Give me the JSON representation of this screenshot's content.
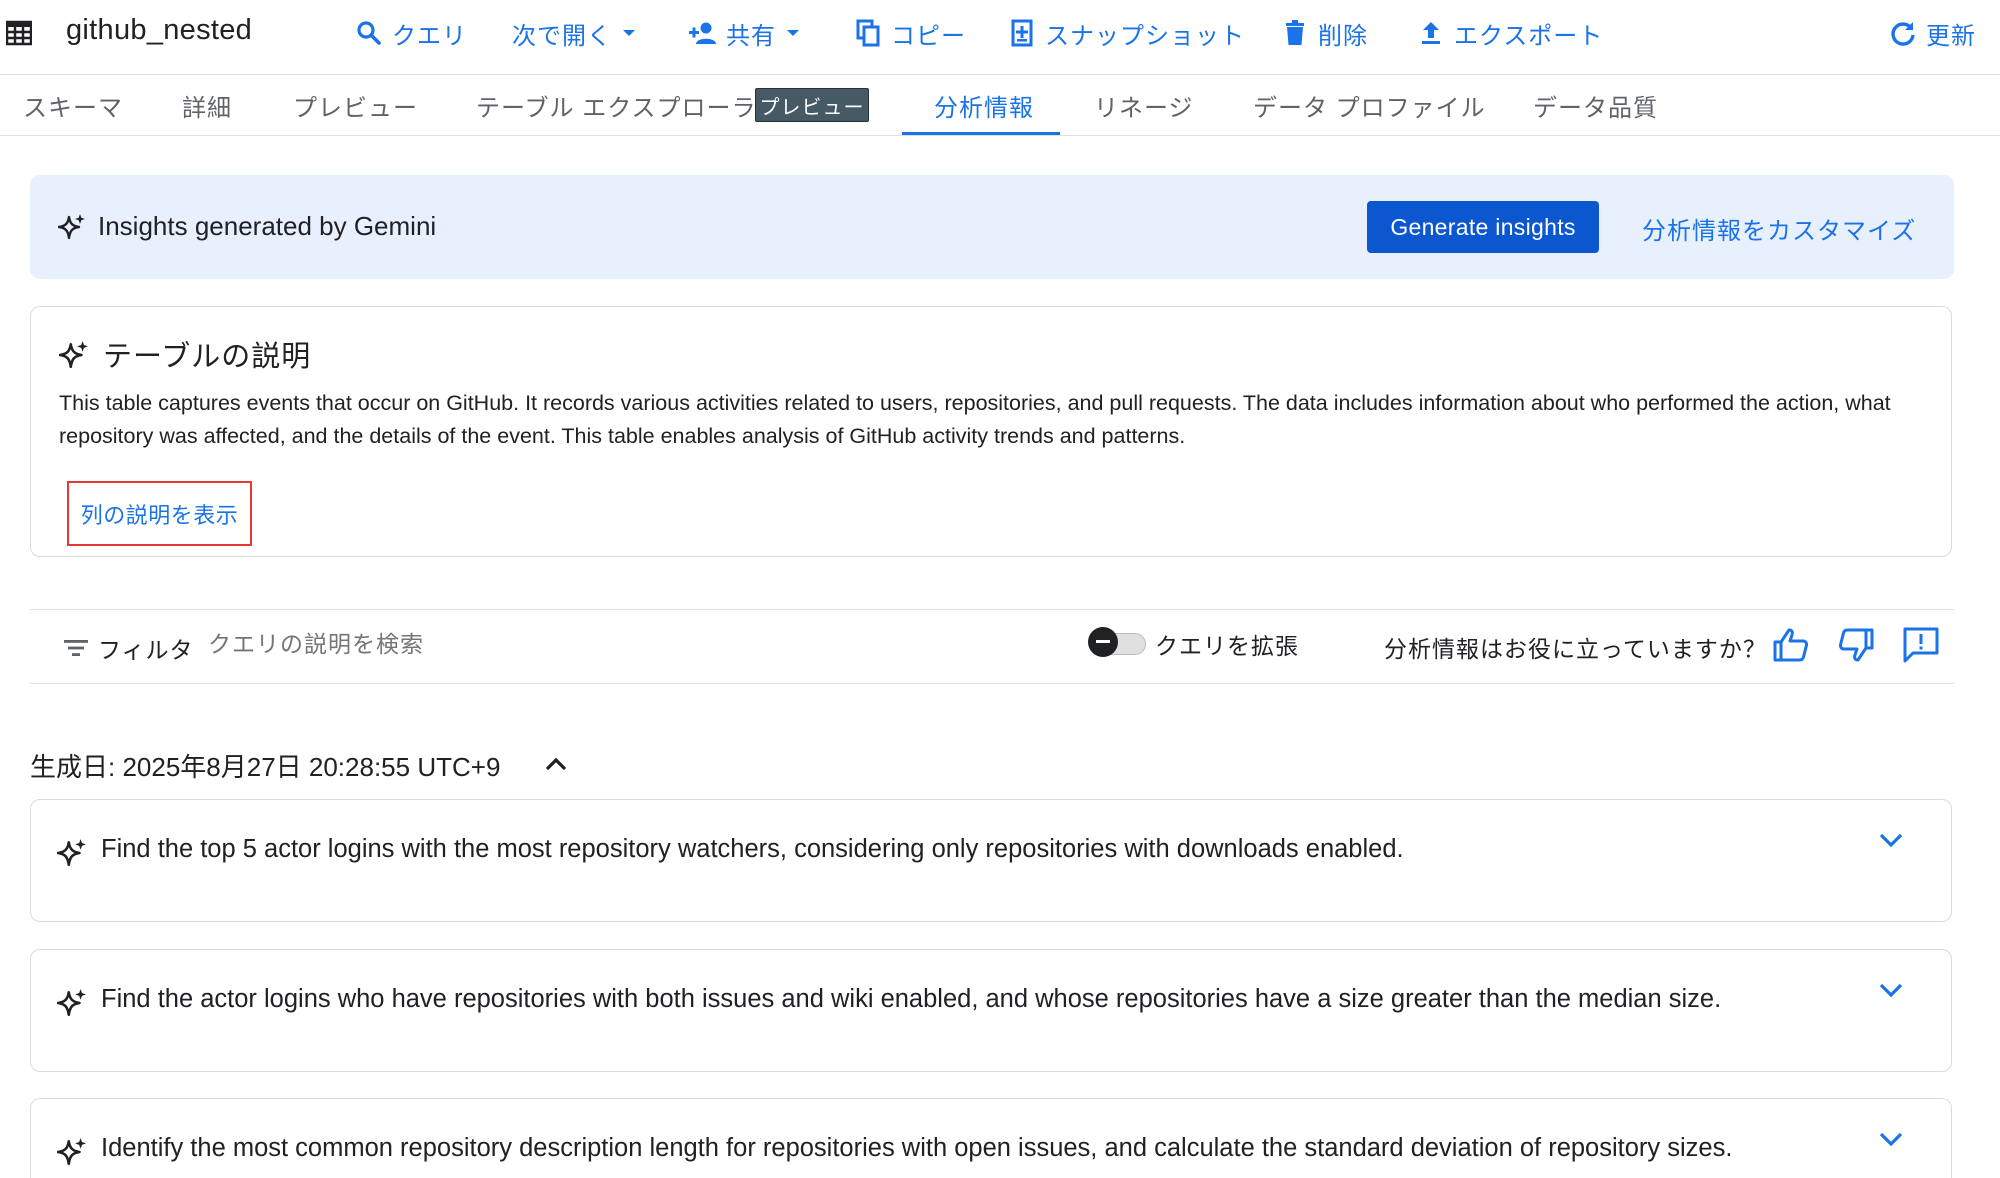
{
  "toolbar": {
    "title": "github_nested",
    "query": "クエリ",
    "open_in": "次で開く",
    "share": "共有",
    "copy": "コピー",
    "snapshot": "スナップショット",
    "delete": "削除",
    "export": "エクスポート",
    "refresh": "更新"
  },
  "tabs": {
    "schema": "スキーマ",
    "details": "詳細",
    "preview": "プレビュー",
    "table_explorer": "テーブル エクスプローラ",
    "preview_badge": "プレビュー",
    "insights": "分析情報",
    "lineage": "リネージ",
    "data_profile": "データ プロファイル",
    "data_quality": "データ品質"
  },
  "banner": {
    "title": "Insights generated by Gemini",
    "generate_button": "Generate insights",
    "customize_link": "分析情報をカスタマイズ"
  },
  "description_card": {
    "heading": "テーブルの説明",
    "body": "This table captures events that occur on GitHub. It records various activities related to users, repositories, and pull requests. The data includes information about who performed the action, what repository was affected, and the details of the event. This table enables analysis of GitHub activity trends and patterns.",
    "show_columns_link": "列の説明を表示"
  },
  "filter_bar": {
    "filter_label": "フィルタ",
    "search_placeholder": "クエリの説明を検索",
    "expand_queries_label": "クエリを拡張",
    "expand_queries_enabled": false,
    "helpful_question": "分析情報はお役に立っていますか？"
  },
  "generated": {
    "label": "生成日: 2025年8月27日 20:28:55 UTC+9"
  },
  "queries": [
    {
      "text": "Find the top 5 actor logins with the most repository watchers, considering only repositories with downloads enabled."
    },
    {
      "text": "Find the actor logins who have repositories with both issues and wiki enabled, and whose repositories have a size greater than the median size."
    },
    {
      "text": "Identify the most common repository description length for repositories with open issues, and calculate the standard deviation of repository sizes."
    }
  ],
  "colors": {
    "accent": "#1a73e8",
    "primary_button": "#0b57d0",
    "banner_bg": "#e8f0fe",
    "highlight_border": "#e53935",
    "preview_chip_bg": "#455a64"
  }
}
